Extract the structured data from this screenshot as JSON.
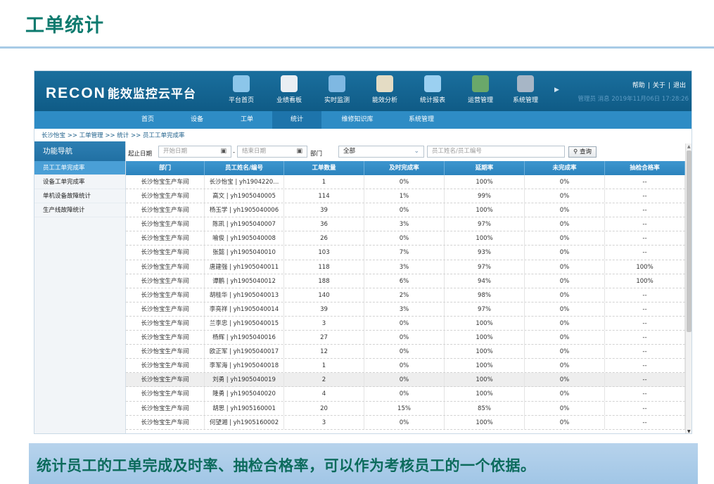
{
  "slide": {
    "title": "工单统计",
    "caption": "统计员工的工单完成及时率、抽检合格率，可以作为考核员工的一个依据。"
  },
  "app": {
    "brand": "RECON",
    "name": "能效监控云平台",
    "modules": [
      {
        "label": "平台首页",
        "icon": "globe-search-icon",
        "color": "#8cc6ea"
      },
      {
        "label": "业绩看板",
        "icon": "line-chart-icon",
        "color": "#e9eef3"
      },
      {
        "label": "实时监测",
        "icon": "monitor-icon",
        "color": "#7fb8e2"
      },
      {
        "label": "能效分析",
        "icon": "presentation-chart-icon",
        "color": "#e4dcc4"
      },
      {
        "label": "统计报表",
        "icon": "screen-report-icon",
        "color": "#9bd0f1"
      },
      {
        "label": "运营管理",
        "icon": "worker-icon",
        "color": "#6aa86a"
      },
      {
        "label": "系统管理",
        "icon": "gear-panel-icon",
        "color": "#a7b6c6"
      }
    ],
    "more_icon": "triangle-right-icon",
    "top_links": [
      "帮助",
      "关于",
      "退出"
    ],
    "user_info": "管理员 消息 2019年11月06日 17:28:26",
    "nav": [
      "首页",
      "设备",
      "工单",
      "统计",
      "维修知识库",
      "系统管理"
    ],
    "active_nav": "统计",
    "breadcrumb": "长沙怡宝 >> 工单管理 >> 统计 >> 员工工单完成率",
    "sidebar": {
      "title": "功能导航",
      "items": [
        "员工工单完成率",
        "设备工单完成率",
        "单机设备故障统计",
        "生产线故障统计"
      ]
    },
    "filter": {
      "date_label": "起止日期",
      "start_placeholder": "开始日期",
      "separator": "-",
      "end_placeholder": "结束日期",
      "calendar_icon": "calendar-icon",
      "dept_label": "部门",
      "dept_value": "全部",
      "search_placeholder": "员工姓名/员工编号",
      "query_label": "查询",
      "query_icon": "search-icon"
    },
    "table": {
      "headers": [
        "部门",
        "员工姓名/编号",
        "工单数量",
        "及时完成率",
        "延期率",
        "未完成率",
        "抽检合格率"
      ],
      "rows": [
        [
          "长沙怡宝生产车间",
          "长沙怡宝 | yh1904220...",
          "1",
          "0%",
          "100%",
          "0%",
          "--"
        ],
        [
          "长沙怡宝生产车间",
          "高文 | yh1905040005",
          "114",
          "1%",
          "99%",
          "0%",
          "--"
        ],
        [
          "长沙怡宝生产车间",
          "杨玉学 | yh1905040006",
          "39",
          "0%",
          "100%",
          "0%",
          "--"
        ],
        [
          "长沙怡宝生产车间",
          "陈凯 | yh1905040007",
          "36",
          "3%",
          "97%",
          "0%",
          "--"
        ],
        [
          "长沙怡宝生产车间",
          "喻俊 | yh1905040008",
          "26",
          "0%",
          "100%",
          "0%",
          "--"
        ],
        [
          "长沙怡宝生产车间",
          "张懿 | yh1905040010",
          "103",
          "7%",
          "93%",
          "0%",
          "--"
        ],
        [
          "长沙怡宝生产车间",
          "唐建强 | yh1905040011",
          "118",
          "3%",
          "97%",
          "0%",
          "100%"
        ],
        [
          "长沙怡宝生产车间",
          "谭鹏 | yh1905040012",
          "188",
          "6%",
          "94%",
          "0%",
          "100%"
        ],
        [
          "长沙怡宝生产车间",
          "胡桂华 | yh1905040013",
          "140",
          "2%",
          "98%",
          "0%",
          "--"
        ],
        [
          "长沙怡宝生产车间",
          "李亮祥 | yh1905040014",
          "39",
          "3%",
          "97%",
          "0%",
          "--"
        ],
        [
          "长沙怡宝生产车间",
          "兰李忠 | yh1905040015",
          "3",
          "0%",
          "100%",
          "0%",
          "--"
        ],
        [
          "长沙怡宝生产车间",
          "杨辉 | yh1905040016",
          "27",
          "0%",
          "100%",
          "0%",
          "--"
        ],
        [
          "长沙怡宝生产车间",
          "欧正军 | yh1905040017",
          "12",
          "0%",
          "100%",
          "0%",
          "--"
        ],
        [
          "长沙怡宝生产车间",
          "李军海 | yh1905040018",
          "1",
          "0%",
          "100%",
          "0%",
          "--"
        ],
        [
          "长沙怡宝生产车间",
          "刘勇 | yh1905040019",
          "2",
          "0%",
          "100%",
          "0%",
          "--"
        ],
        [
          "长沙怡宝生产车间",
          "隆勇 | yh1905040020",
          "4",
          "0%",
          "100%",
          "0%",
          "--"
        ],
        [
          "长沙怡宝生产车间",
          "胡思 | yh1905160001",
          "20",
          "15%",
          "85%",
          "0%",
          "--"
        ],
        [
          "长沙怡宝生产车间",
          "何望湘 | yh1905160002",
          "3",
          "0%",
          "100%",
          "0%",
          "--"
        ]
      ],
      "highlighted_row": 14
    }
  }
}
